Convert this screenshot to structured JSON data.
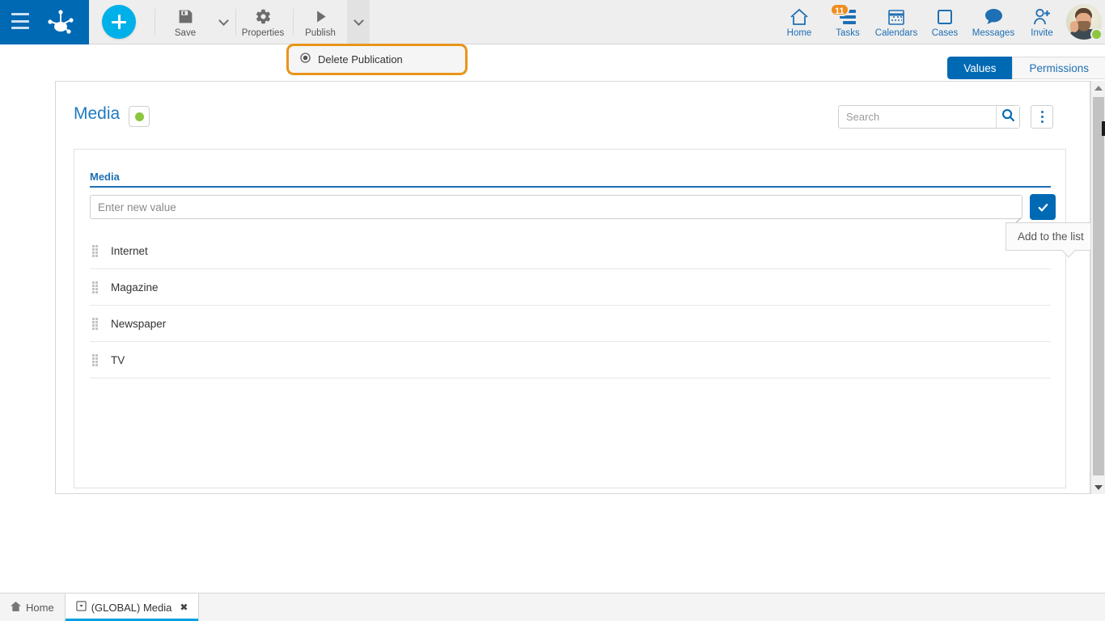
{
  "topbar": {
    "menu_icon": "hamburger-icon",
    "logo_icon": "app-logo-icon",
    "add_icon": "plus-icon",
    "actions": [
      {
        "label": "Save",
        "icon": "save-icon"
      },
      {
        "label": "Properties",
        "icon": "gear-icon"
      },
      {
        "label": "Publish",
        "icon": "play-icon"
      }
    ],
    "nav": [
      {
        "label": "Home",
        "icon": "home-icon",
        "badge": ""
      },
      {
        "label": "Tasks",
        "icon": "tasks-icon",
        "badge": "11"
      },
      {
        "label": "Calendars",
        "icon": "calendar-icon",
        "badge": ""
      },
      {
        "label": "Cases",
        "icon": "cases-icon",
        "badge": ""
      },
      {
        "label": "Messages",
        "icon": "message-icon",
        "badge": ""
      },
      {
        "label": "Invite",
        "icon": "invite-user-icon",
        "badge": ""
      }
    ],
    "avatar": {
      "name": "avatar",
      "status": "online"
    }
  },
  "publish_menu": {
    "items": [
      {
        "label": "Delete Publication",
        "icon": "radio-filled-icon"
      }
    ],
    "highlight_color": "#e8951a"
  },
  "tabs": [
    {
      "label": "Values",
      "selected": true
    },
    {
      "label": "Permissions",
      "selected": false
    }
  ],
  "card": {
    "title": "Media",
    "status_color": "#8dc63f",
    "search": {
      "value": "",
      "placeholder": "Search",
      "icon": "search-icon"
    },
    "more_menu_icon": "kebab-menu-icon"
  },
  "panel": {
    "field_label": "Media",
    "new_value": {
      "value": "",
      "placeholder": "Enter new value"
    },
    "confirm_icon": "check-icon",
    "tooltip": "Add to the list",
    "items": [
      {
        "label": "Internet"
      },
      {
        "label": "Magazine"
      },
      {
        "label": "Newspaper"
      },
      {
        "label": "TV"
      }
    ]
  },
  "taskbar": {
    "tabs": [
      {
        "label": "Home",
        "icon": "home-small-icon",
        "active": false,
        "closable": false
      },
      {
        "label": "(GLOBAL) Media",
        "icon": "window-icon",
        "active": true,
        "closable": true
      }
    ],
    "close_glyph": "✖"
  }
}
